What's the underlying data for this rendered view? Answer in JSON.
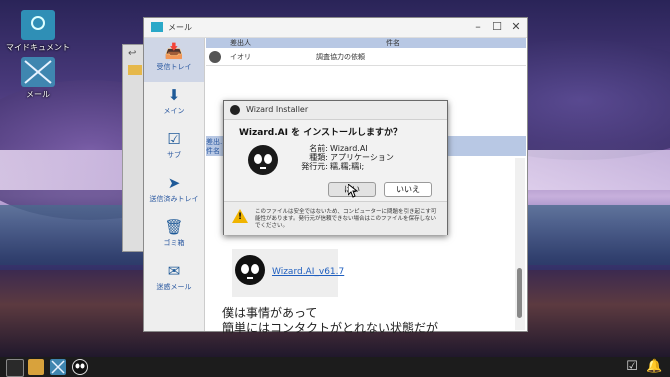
{
  "desktop": {
    "icons": [
      {
        "label": "マイドキュメント"
      },
      {
        "label": "メール"
      }
    ]
  },
  "mail": {
    "title": "メール",
    "sidebar": [
      {
        "label": "受信トレイ",
        "icon": "inbox-icon"
      },
      {
        "label": "メイン",
        "icon": "download-icon"
      },
      {
        "label": "サブ",
        "icon": "check-tray-icon"
      },
      {
        "label": "送信済みトレイ",
        "icon": "send-icon"
      },
      {
        "label": "ゴミ箱",
        "icon": "trash-icon"
      },
      {
        "label": "迷惑メール",
        "icon": "spam-icon"
      }
    ],
    "list_header": {
      "from": "差出人",
      "subject": "件名"
    },
    "row": {
      "from": "イオリ",
      "subject": "調査協力の依頼"
    },
    "preview_header": {
      "from": "差出..",
      "subject": "件名"
    },
    "attachment": {
      "name": "Wizard.AI_v61.7"
    },
    "body_lines": [
      "僕は事情があって",
      "簡単にはコンタクトがとれない状態だが"
    ]
  },
  "installer": {
    "title": "Wizard Installer",
    "question": "Wizard.AI を インストールしますか？",
    "name_key": "名前:",
    "name_value": "Wizard.AI",
    "type_key": "種類:",
    "type_value": "アプリケーション",
    "publisher_key": "発行元:",
    "publisher_value": "糯,糯;糯i;",
    "yes_label": "はい",
    "no_label": "いいえ",
    "warning": "このファイルは安全ではないため、コンピューターに問題を引き起こす可能性があります。発行元が信頼できない場合はこのファイルを保存しないでください。"
  },
  "colors": {
    "accent": "#1f5a98",
    "selected": "#cfd6e6",
    "header": "#b8c8e4",
    "warning": "#f0b400"
  }
}
